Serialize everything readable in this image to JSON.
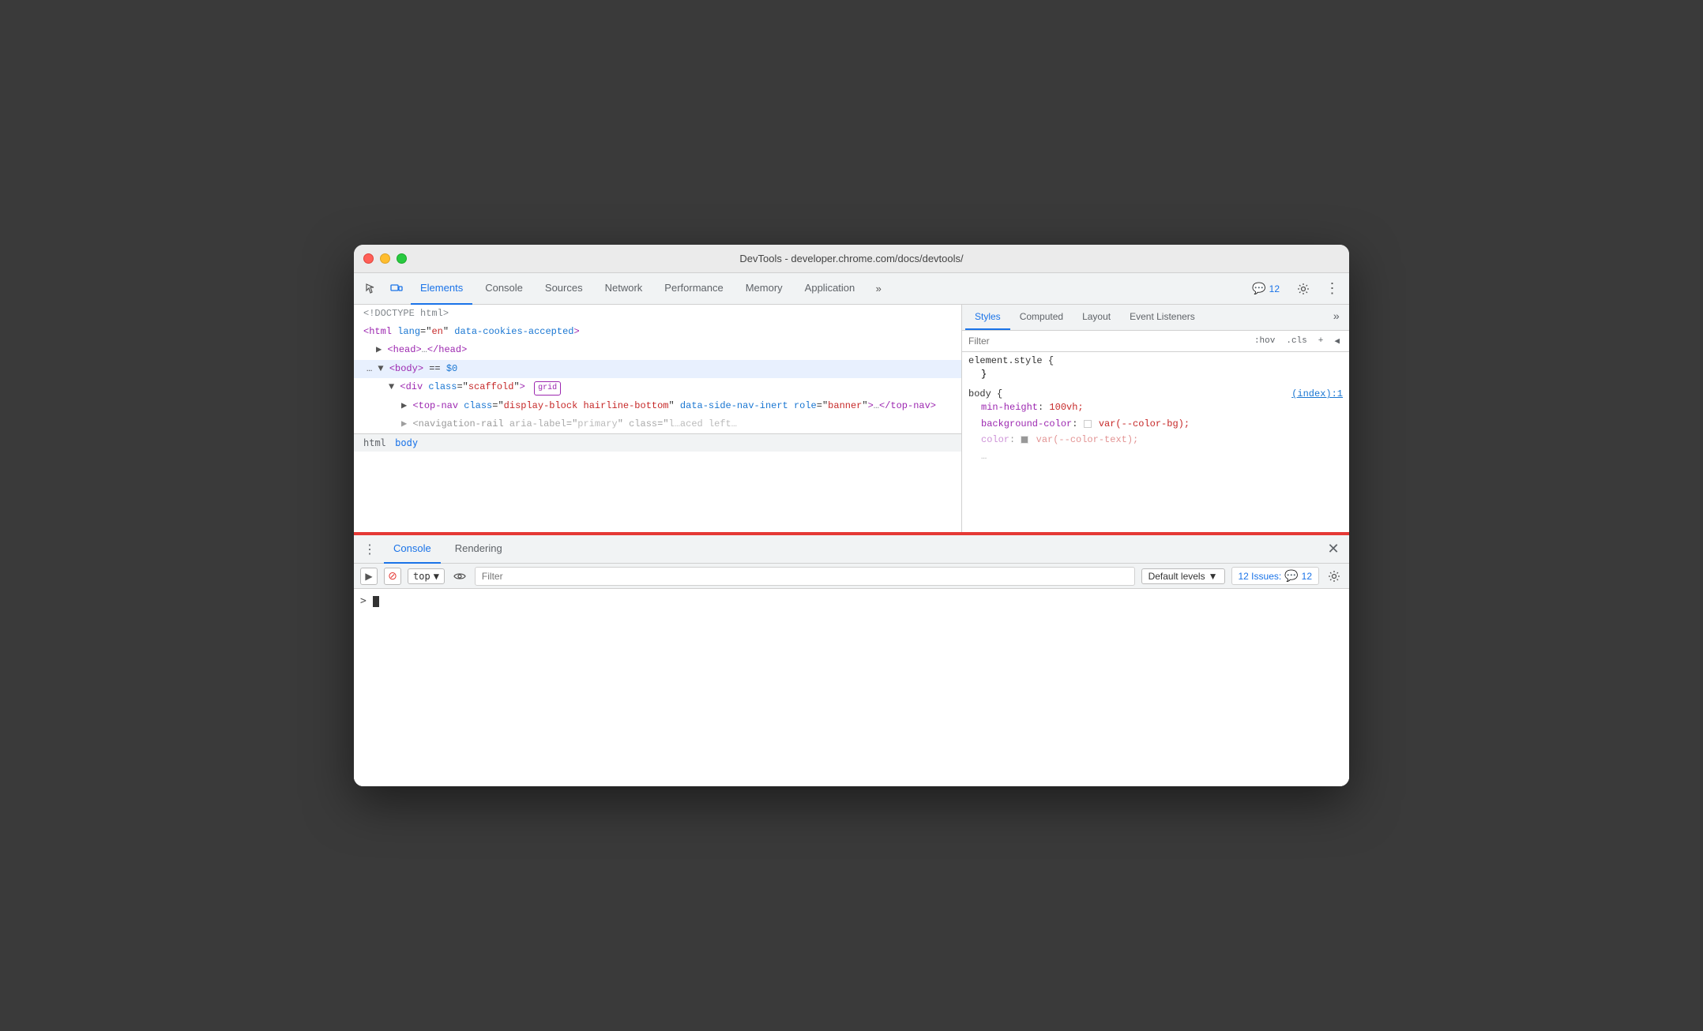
{
  "window": {
    "title": "DevTools - developer.chrome.com/docs/devtools/"
  },
  "toolbar": {
    "tabs": [
      {
        "id": "elements",
        "label": "Elements",
        "active": true
      },
      {
        "id": "console",
        "label": "Console",
        "active": false
      },
      {
        "id": "sources",
        "label": "Sources",
        "active": false
      },
      {
        "id": "network",
        "label": "Network",
        "active": false
      },
      {
        "id": "performance",
        "label": "Performance",
        "active": false
      },
      {
        "id": "memory",
        "label": "Memory",
        "active": false
      },
      {
        "id": "application",
        "label": "Application",
        "active": false
      }
    ],
    "more_label": "»",
    "issues_count": "12",
    "issues_label": "12"
  },
  "elements_panel": {
    "html": [
      {
        "indent": 0,
        "text": "<!DOCTYPE html>",
        "type": "comment"
      },
      {
        "indent": 0,
        "text": "<html lang=\"en\" data-cookies-accepted>",
        "type": "tag"
      },
      {
        "indent": 1,
        "text": "▶ <head>…</head>",
        "type": "tag"
      },
      {
        "indent": 1,
        "text": "▼ <body> == $0",
        "type": "tag",
        "selected": true
      },
      {
        "indent": 2,
        "text": "▼ <div class=\"scaffold\"> grid",
        "type": "tag",
        "badge": "grid"
      },
      {
        "indent": 3,
        "text": "▶ <top-nav class=\"display-block hairline-bottom\" data-side-nav-inert role=\"banner\">…</top-nav>",
        "type": "tag"
      },
      {
        "indent": 3,
        "text": "▶ <navigation-rail aria-label=\"primary\" class=\"l…aced left…",
        "type": "tag"
      }
    ]
  },
  "breadcrumb": {
    "items": [
      "html",
      "body"
    ]
  },
  "styles_panel": {
    "tabs": [
      {
        "id": "styles",
        "label": "Styles",
        "active": true
      },
      {
        "id": "computed",
        "label": "Computed",
        "active": false
      },
      {
        "id": "layout",
        "label": "Layout",
        "active": false
      },
      {
        "id": "event_listeners",
        "label": "Event Listeners",
        "active": false
      }
    ],
    "filter_placeholder": "Filter",
    "filter_actions": [
      ":hov",
      ".cls",
      "+"
    ],
    "rules": [
      {
        "selector": "element.style {",
        "close": "}",
        "source": "",
        "properties": []
      },
      {
        "selector": "body {",
        "close": "}",
        "source": "(index):1",
        "properties": [
          {
            "name": "min-height",
            "value": "100vh;"
          },
          {
            "name": "background-color",
            "value": "var(--color-bg);",
            "swatch": true
          },
          {
            "name": "color",
            "value": "var(--color-text);",
            "swatch": true
          }
        ]
      }
    ]
  },
  "console_panel": {
    "tabs": [
      {
        "id": "console",
        "label": "Console",
        "active": true
      },
      {
        "id": "rendering",
        "label": "Rendering",
        "active": false
      }
    ],
    "close_label": "×",
    "input_bar": {
      "top_label": "top",
      "filter_placeholder": "Filter",
      "default_levels_label": "Default levels",
      "issues_label": "12 Issues:",
      "issues_count": "12"
    },
    "prompt_arrow": ">"
  }
}
